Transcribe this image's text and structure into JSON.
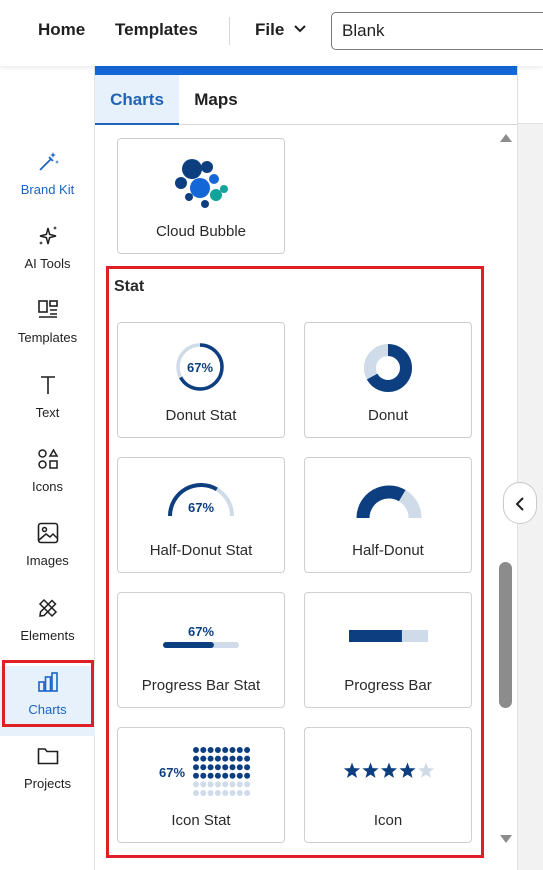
{
  "topbar": {
    "home": "Home",
    "templates": "Templates",
    "file": "File",
    "title_value": "Blank"
  },
  "rail": {
    "items": [
      {
        "label": "Brand Kit",
        "icon": "magic-wand-icon"
      },
      {
        "label": "AI Tools",
        "icon": "sparkles-icon"
      },
      {
        "label": "Templates",
        "icon": "layout-icon"
      },
      {
        "label": "Text",
        "icon": "text-icon"
      },
      {
        "label": "Icons",
        "icon": "shapes-icon"
      },
      {
        "label": "Images",
        "icon": "image-icon"
      },
      {
        "label": "Elements",
        "icon": "pencil-ruler-icon"
      },
      {
        "label": "Charts",
        "icon": "bar-chart-icon"
      },
      {
        "label": "Projects",
        "icon": "folder-icon"
      }
    ],
    "active": "Charts"
  },
  "panel": {
    "tabs": [
      "Charts",
      "Maps"
    ],
    "active_tab": "Charts",
    "section": "Stat",
    "cards": {
      "cloud_bubble": "Cloud Bubble",
      "donut_stat": "Donut Stat",
      "donut": "Donut",
      "half_donut_stat": "Half-Donut Stat",
      "half_donut": "Half-Donut",
      "progress_bar_stat": "Progress Bar Stat",
      "progress_bar": "Progress Bar",
      "icon_stat": "Icon Stat",
      "icon": "Icon"
    },
    "stat_value": "67%",
    "stat_fraction": 0.67,
    "icon_rating": {
      "filled": 4,
      "total": 5
    }
  },
  "colors": {
    "accent": "#1467d6",
    "navy": "#0d3f80",
    "light": "#cfdbe8",
    "highlight": "#e01e26"
  }
}
